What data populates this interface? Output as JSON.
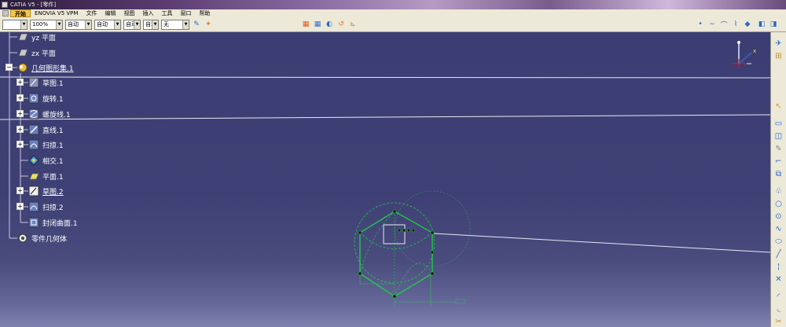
{
  "window": {
    "title": "CATIA V5 - [零件]"
  },
  "menu": {
    "start": "开始",
    "items": [
      "ENOVIA V5 VPM",
      "文件",
      "编辑",
      "视图",
      "插入",
      "工具",
      "窗口",
      "帮助"
    ]
  },
  "toolbar": {
    "combo_blank": "",
    "zoom": "100%",
    "line_type": "自动",
    "line_weight": "自动",
    "layer": "自动",
    "pattern": "自动",
    "layer_name": "无"
  },
  "tree": {
    "items": [
      {
        "label": "yz 平面",
        "icon": "plane-icon"
      },
      {
        "label": "zx 平面",
        "icon": "plane-icon"
      },
      {
        "label": "几何图形集.1",
        "icon": "geometric-set-icon"
      },
      {
        "label": "草图.1",
        "icon": "sketch-icon"
      },
      {
        "label": "旋转.1",
        "icon": "revolve-icon"
      },
      {
        "label": "螺旋线.1",
        "icon": "helix-icon"
      },
      {
        "label": "直线.1",
        "icon": "line-icon"
      },
      {
        "label": "扫掠.1",
        "icon": "sweep-icon"
      },
      {
        "label": "相交.1",
        "icon": "intersect-icon"
      },
      {
        "label": "平面.1",
        "icon": "plane-icon"
      },
      {
        "label": "草图.2",
        "icon": "sketch-icon"
      },
      {
        "label": "扫掠.2",
        "icon": "sweep-icon"
      },
      {
        "label": "封闭曲面.1",
        "icon": "close-surface-icon"
      },
      {
        "label": "零件几何体",
        "icon": "part-body-icon"
      }
    ]
  },
  "compass": {
    "axis_label": "x"
  },
  "colors": {
    "background": "#3d3f70",
    "sketch_green": "#22c84a",
    "toolbar": "#ece9d8"
  }
}
